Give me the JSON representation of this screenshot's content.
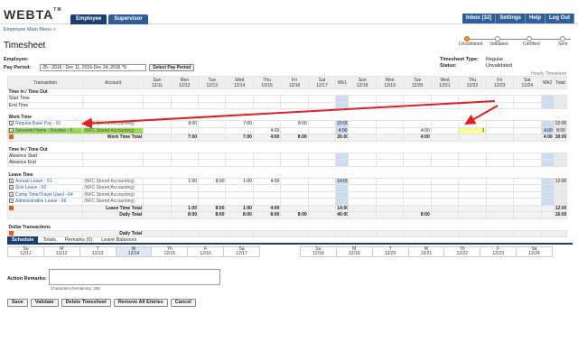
{
  "app": {
    "logo": "WEBTA",
    "logo_tm": "TM",
    "nav": [
      "Employee",
      "Supervisor"
    ],
    "util": [
      "Inbox [32]",
      "Settings",
      "Help",
      "Log Out"
    ]
  },
  "breadcrumb": "Employee Main Menu >",
  "page_title": "Timesheet",
  "status_steps": [
    "Unvalidated",
    "Validated",
    "Certified",
    "Sent"
  ],
  "status_current_index": 0,
  "employee_label": "Employee:",
  "payperiod": {
    "label": "Pay Period:",
    "value": "25 - 2016 : Dec 11, 2016-Dec 24, 2016 *S",
    "button": "Select Pay Period"
  },
  "timesheet_info": {
    "type_label": "Timesheet Type:",
    "type_value": "Regular",
    "status_label": "Status:",
    "status_value": "Unvalidated"
  },
  "hourly_label": "Hourly Timesheet",
  "columns": {
    "transaction": "Transaction",
    "account": "Account",
    "days_w1": [
      [
        "Sun",
        "12/11"
      ],
      [
        "Mon",
        "12/12"
      ],
      [
        "Tue",
        "12/13"
      ],
      [
        "Wed",
        "12/14"
      ],
      [
        "Thu",
        "12/15"
      ],
      [
        "Fri",
        "12/16"
      ],
      [
        "Sat",
        "12/17"
      ]
    ],
    "wk1": "Wk1",
    "days_w2": [
      [
        "Sun",
        "12/18"
      ],
      [
        "Mon",
        "12/19"
      ],
      [
        "Tue",
        "12/20"
      ],
      [
        "Wed",
        "12/21"
      ],
      [
        "Thu",
        "12/22"
      ],
      [
        "Fri",
        "12/23"
      ],
      [
        "Sat",
        "12/24"
      ]
    ],
    "wk2": "Wk2",
    "total": "Total"
  },
  "time_in_out": {
    "header": "Time In / Time Out",
    "start": "Start Time",
    "end": "End Time"
  },
  "work_time": {
    "header": "Work Time",
    "rows": [
      {
        "transaction": "Regular Base Pay - 01",
        "account": "(NFC Stored Accounting)",
        "w1": [
          "",
          "8:00",
          "",
          "7:00",
          "",
          "8:00",
          ""
        ],
        "wk1": "22:00",
        "w2": [
          "",
          "",
          "",
          "",
          "",
          "",
          ""
        ],
        "wk2": "",
        "total": "22:00"
      },
      {
        "transaction": "Telework Home - Routine - 6...",
        "account": "(NFC Stored Accounting)",
        "w1": [
          "",
          "",
          "",
          "",
          "4:00",
          "",
          ""
        ],
        "wk1": "4:00",
        "w2": [
          "",
          "",
          "4:00",
          "",
          "1",
          "",
          ""
        ],
        "wk2": "4:00",
        "total": "8:00"
      }
    ],
    "total_label": "Work Time Total",
    "total_row": {
      "w1": [
        "",
        "7:00",
        "",
        "7:00",
        "4:00",
        "8:00",
        ""
      ],
      "wk1": "26:00",
      "w2": [
        "",
        "",
        "4:00",
        "",
        "",
        "",
        ""
      ],
      "wk2": "4:00",
      "total": "30:00"
    }
  },
  "absence": {
    "header": "Time In / Time Out",
    "start": "Absence Start",
    "end": "Absence End"
  },
  "leave_time": {
    "header": "Leave Time",
    "rows": [
      {
        "transaction": "Annual Leave - 61",
        "account": "(NFC Stored Accounting)",
        "w1": [
          "",
          "1:00",
          "8:00",
          "1:00",
          "4:00",
          "",
          ""
        ],
        "wk1": "14:00",
        "w2": [
          "",
          "",
          "",
          "",
          "",
          "",
          ""
        ],
        "wk2": "",
        "total": "12:00 26:00"
      },
      {
        "transaction": "Sick Leave - 62",
        "account": "(NFC Stored Accounting)",
        "w1": [
          "",
          "",
          "",
          "",
          "",
          "",
          ""
        ],
        "wk1": "",
        "w2": [
          "",
          "",
          "",
          "",
          "",
          "",
          ""
        ],
        "wk2": "",
        "total": ""
      },
      {
        "transaction": "Comp Time/Travel Used - 64",
        "account": "(NFC Stored Accounting)",
        "w1": [
          "",
          "",
          "",
          "",
          "",
          "",
          ""
        ],
        "wk1": "",
        "w2": [
          "",
          "",
          "",
          "",
          "",
          "",
          ""
        ],
        "wk2": "",
        "total": ""
      },
      {
        "transaction": "Administrative Leave - 66",
        "account": "(NFC Stored Accounting)",
        "w1": [
          "",
          "",
          "",
          "",
          "",
          "",
          ""
        ],
        "wk1": "",
        "w2": [
          "",
          "",
          "",
          "",
          "",
          "",
          ""
        ],
        "wk2": "",
        "total": ""
      }
    ],
    "total_label": "Leave Time Total",
    "total_row": {
      "w1": [
        "",
        "1:00",
        "8:00",
        "1:00",
        "4:00",
        "",
        ""
      ],
      "wk1": "14:00",
      "w2": [
        "",
        "",
        "",
        "",
        "",
        "",
        ""
      ],
      "wk2": "",
      "total": "12:00 26:00"
    },
    "daily_label": "Daily Total",
    "daily_row": {
      "w1": [
        "",
        "8:00",
        "8:00",
        "8:00",
        "8:00",
        "8:00",
        ""
      ],
      "wk1": "40:00",
      "w2": [
        "",
        "",
        "8:00",
        "",
        "",
        "",
        ""
      ],
      "wk2": "",
      "total": "16:00 56:00"
    }
  },
  "dollar": {
    "header": "Dollar Transactions",
    "daily_label": "Daily Total"
  },
  "tabs": [
    "Schedule",
    "Totals",
    "Remarks (0)",
    "Leave Balances"
  ],
  "schedule_w1": [
    [
      "Su",
      "12/11"
    ],
    [
      "M",
      "12/12"
    ],
    [
      "T",
      "12/13"
    ],
    [
      "W",
      "12/14"
    ],
    [
      "Th",
      "12/15"
    ],
    [
      "F",
      "12/16"
    ],
    [
      "Sa",
      "12/17"
    ]
  ],
  "schedule_w2": [
    [
      "Su",
      "12/18"
    ],
    [
      "M",
      "12/19"
    ],
    [
      "T",
      "12/20"
    ],
    [
      "W",
      "12/21"
    ],
    [
      "Th",
      "12/22"
    ],
    [
      "F",
      "12/23"
    ],
    [
      "Sa",
      "12/24"
    ]
  ],
  "remarks": {
    "label": "Action Remarks:",
    "remaining": "Characters Remaining: 255"
  },
  "actions": [
    "Save",
    "Validate",
    "Delete Timesheet",
    "Remove All Entries",
    "Cancel"
  ],
  "colors": {
    "nav_blue": "#1b3f70",
    "week_total": "#c9dcf2",
    "highlight_green": "#9ddb4e",
    "highlight_yellow": "#fffb9a",
    "arrow_red": "#e0201c",
    "add_orange": "#e2601c"
  }
}
